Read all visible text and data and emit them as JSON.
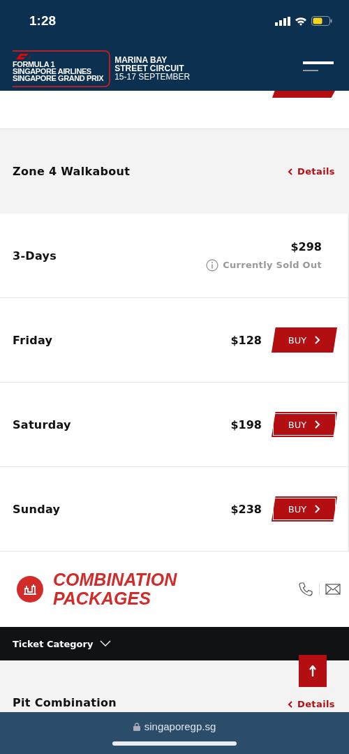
{
  "status_bar": {
    "time": "1:28"
  },
  "header": {
    "logo_lines": [
      "FORMULA 1",
      "SINGAPORE AIRLINES",
      "SINGAPORE GRAND PRIX"
    ],
    "venue_lines": [
      "MARINA BAY",
      "STREET CIRCUIT",
      "15-17 SEPTEMBER"
    ]
  },
  "zone": {
    "title": "Zone 4 Walkabout",
    "details_label": "Details"
  },
  "tickets": [
    {
      "kind": "sold_out",
      "name": "3-Days",
      "price": "$298",
      "note": "Currently Sold Out"
    },
    {
      "kind": "buy",
      "name": "Friday",
      "price": "$128",
      "button": "BUY"
    },
    {
      "kind": "buy",
      "name": "Saturday",
      "price": "$198",
      "button": "BUY"
    },
    {
      "kind": "buy",
      "name": "Sunday",
      "price": "$238",
      "button": "BUY"
    }
  ],
  "section": {
    "title_lines": [
      "COMBINATION",
      "PACKAGES"
    ]
  },
  "filter_bar": {
    "label": "Ticket Category"
  },
  "package": {
    "title": "Pit Combination",
    "details_label": "Details"
  },
  "browser_bar": {
    "url": "singaporegp.sg"
  }
}
